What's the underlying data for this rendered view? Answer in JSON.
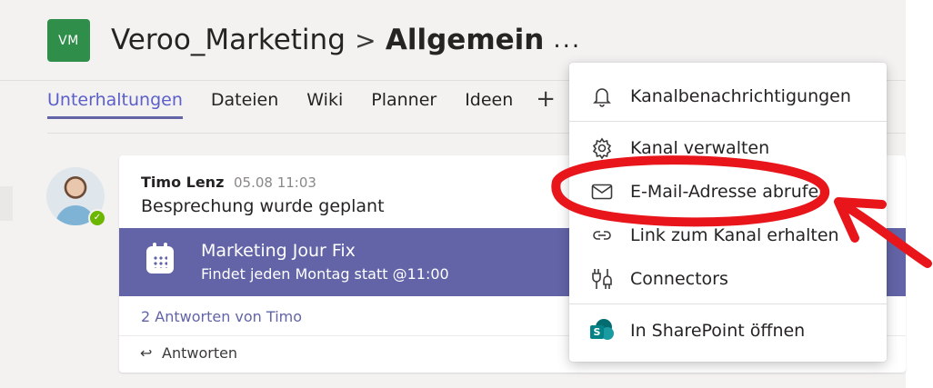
{
  "header": {
    "team_initials": "VM",
    "team_name": "Veroo_Marketing",
    "separator": ">",
    "channel_name": "Allgemein",
    "more_label": "..."
  },
  "tabs": [
    {
      "label": "Unterhaltungen",
      "active": true
    },
    {
      "label": "Dateien"
    },
    {
      "label": "Wiki"
    },
    {
      "label": "Planner"
    },
    {
      "label": "Ideen"
    }
  ],
  "tab_add_label": "+",
  "post": {
    "author": "Timo Lenz",
    "time": "05.08 11:03",
    "text": "Besprechung wurde geplant",
    "presence": "available",
    "meeting": {
      "title": "Marketing Jour Fix",
      "subtitle": "Findet jeden Montag statt @11:00"
    },
    "replies_link": "2 Antworten von Timo",
    "reply_label": "Antworten"
  },
  "menu": {
    "items": [
      {
        "label": "Kanalbenachrichtigungen",
        "icon": "bell-icon"
      },
      {
        "label": "Kanal verwalten",
        "icon": "gear-icon"
      },
      {
        "label": "E-Mail-Adresse abrufen",
        "icon": "envelope-icon"
      },
      {
        "label": "Link zum Kanal erhalten",
        "icon": "link-icon"
      },
      {
        "label": "Connectors",
        "icon": "connectors-icon"
      },
      {
        "label": "In SharePoint öffnen",
        "icon": "sharepoint-icon"
      }
    ]
  },
  "colors": {
    "accent": "#6264a7",
    "team_avatar": "#2f8f4a",
    "annotation": "#e8151b",
    "presence": "#6bb700"
  }
}
